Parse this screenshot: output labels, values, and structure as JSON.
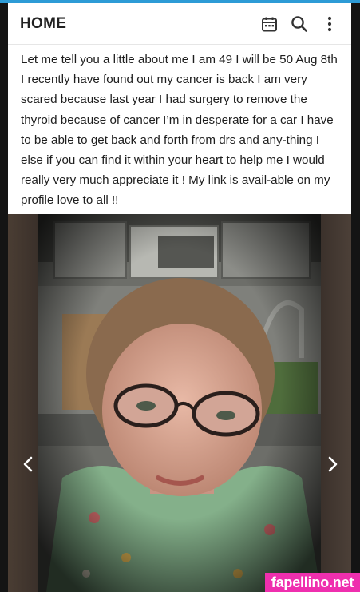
{
  "header": {
    "title": "HOME",
    "icons": [
      "calendar-icon",
      "search-icon",
      "more-vertical-icon"
    ]
  },
  "post": {
    "text": "Let me tell you a little about me I am 49 I will be 50 Aug 8th I recently have found out my cancer is back I am very scared because last year I had surgery to remove the thyroid because of cancer I’m in desperate for a car I have to be able to get back and forth from drs and any-thing I else if you can find it within your heart to help me I would really very much appreciate it ! My link is avail-able on my profile love to all !!"
  },
  "gallery": {
    "prev_icon": "chevron-left-icon",
    "next_icon": "chevron-right-icon"
  },
  "watermark": {
    "text": "fapellino.net"
  },
  "colors": {
    "accent_strip": "#2d9bd6",
    "watermark_bg": "#ef2fae"
  }
}
